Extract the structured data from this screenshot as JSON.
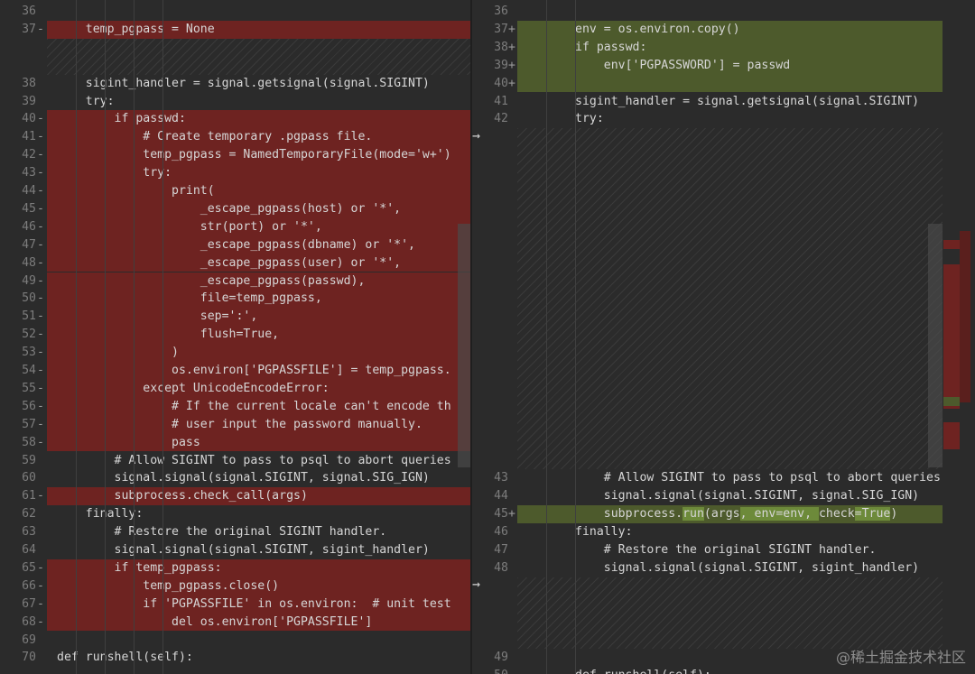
{
  "left_lines": [
    {
      "num": "36",
      "text": "",
      "type": "ctx"
    },
    {
      "num": "37",
      "marker": "-",
      "text": "    temp_pgpass = None",
      "type": "del"
    },
    {
      "num": "38",
      "text": "    sigint_handler = signal.getsignal(signal.SIGINT)",
      "type": "ctx"
    },
    {
      "num": "39",
      "text": "    try:",
      "type": "ctx"
    },
    {
      "num": "40",
      "marker": "-",
      "text": "        if passwd:",
      "type": "del"
    },
    {
      "num": "41",
      "marker": "-",
      "text": "            # Create temporary .pgpass file.",
      "type": "del"
    },
    {
      "num": "42",
      "marker": "-",
      "text": "            temp_pgpass = NamedTemporaryFile(mode='w+')",
      "type": "del"
    },
    {
      "num": "43",
      "marker": "-",
      "text": "            try:",
      "type": "del"
    },
    {
      "num": "44",
      "marker": "-",
      "text": "                print(",
      "type": "del"
    },
    {
      "num": "45",
      "marker": "-",
      "text": "                    _escape_pgpass(host) or '*',",
      "type": "del"
    },
    {
      "num": "46",
      "marker": "-",
      "text": "                    str(port) or '*',",
      "type": "del"
    },
    {
      "num": "47",
      "marker": "-",
      "text": "                    _escape_pgpass(dbname) or '*',",
      "type": "del"
    },
    {
      "num": "48",
      "marker": "-",
      "text": "                    _escape_pgpass(user) or '*',",
      "type": "del"
    },
    {
      "num": "49",
      "marker": "-",
      "text": "                    _escape_pgpass(passwd),",
      "type": "del"
    },
    {
      "num": "50",
      "marker": "-",
      "text": "                    file=temp_pgpass,",
      "type": "del"
    },
    {
      "num": "51",
      "marker": "-",
      "text": "                    sep=':',",
      "type": "del"
    },
    {
      "num": "52",
      "marker": "-",
      "text": "                    flush=True,",
      "type": "del"
    },
    {
      "num": "53",
      "marker": "-",
      "text": "                )",
      "type": "del"
    },
    {
      "num": "54",
      "marker": "-",
      "text": "                os.environ['PGPASSFILE'] = temp_pgpass.",
      "type": "del"
    },
    {
      "num": "55",
      "marker": "-",
      "text": "            except UnicodeEncodeError:",
      "type": "del"
    },
    {
      "num": "56",
      "marker": "-",
      "text": "                # If the current locale can't encode th",
      "type": "del"
    },
    {
      "num": "57",
      "marker": "-",
      "text": "                # user input the password manually.",
      "type": "del"
    },
    {
      "num": "58",
      "marker": "-",
      "text": "                pass",
      "type": "del"
    },
    {
      "num": "59",
      "text": "        # Allow SIGINT to pass to psql to abort queries",
      "type": "ctx"
    },
    {
      "num": "60",
      "text": "        signal.signal(signal.SIGINT, signal.SIG_IGN)",
      "type": "ctx"
    },
    {
      "num": "61",
      "marker": "-",
      "text": "        subprocess.check_call(args)",
      "type": "del"
    },
    {
      "num": "62",
      "text": "    finally:",
      "type": "ctx"
    },
    {
      "num": "63",
      "text": "        # Restore the original SIGINT handler.",
      "type": "ctx"
    },
    {
      "num": "64",
      "text": "        signal.signal(signal.SIGINT, sigint_handler)",
      "type": "ctx"
    },
    {
      "num": "65",
      "marker": "-",
      "text": "        if temp_pgpass:",
      "type": "del"
    },
    {
      "num": "66",
      "marker": "-",
      "text": "            temp_pgpass.close()",
      "type": "del"
    },
    {
      "num": "67",
      "marker": "-",
      "text": "            if 'PGPASSFILE' in os.environ:  # unit test",
      "type": "del"
    },
    {
      "num": "68",
      "marker": "-",
      "text": "                del os.environ['PGPASSFILE']",
      "type": "del"
    },
    {
      "num": "69",
      "text": "",
      "type": "ctx"
    },
    {
      "num": "70",
      "text": "def runshell(self):",
      "type": "ctx"
    }
  ],
  "right_lines": [
    {
      "num": "36",
      "text": "",
      "type": "ctx"
    },
    {
      "num": "37",
      "marker": "+",
      "text": "env = os.environ.copy()",
      "type": "add"
    },
    {
      "num": "38",
      "marker": "+",
      "text": "if passwd:",
      "type": "add"
    },
    {
      "num": "39",
      "marker": "+",
      "text": "    env['PGPASSWORD'] = passwd",
      "type": "add"
    },
    {
      "num": "40",
      "marker": "+",
      "text": "",
      "type": "add"
    },
    {
      "num": "41",
      "text": "sigint_handler = signal.getsignal(signal.SIGINT)",
      "type": "ctx"
    },
    {
      "num": "42",
      "text": "try:",
      "type": "ctx"
    },
    {
      "num": "43",
      "text": "    # Allow SIGINT to pass to psql to abort queries",
      "type": "ctx"
    },
    {
      "num": "44",
      "text": "    signal.signal(signal.SIGINT, signal.SIG_IGN)",
      "type": "ctx"
    },
    {
      "num": "45",
      "marker": "+",
      "text_parts": [
        "    subprocess.",
        "run",
        "(args",
        ", env=env, ",
        "check",
        "=True",
        ")"
      ],
      "type": "add"
    },
    {
      "num": "46",
      "text": "finally:",
      "type": "ctx"
    },
    {
      "num": "47",
      "text": "    # Restore the original SIGINT handler.",
      "type": "ctx"
    },
    {
      "num": "48",
      "text": "    signal.signal(signal.SIGINT, sigint_handler)",
      "type": "ctx"
    },
    {
      "num": "49",
      "text": "",
      "type": "ctx"
    },
    {
      "num": "50",
      "text": "def runshell(self):",
      "type": "ctx"
    }
  ],
  "arrows": [
    "→",
    "→"
  ],
  "watermark": "@稀土掘金技术社区",
  "colors": {
    "deleted": "#6e2321",
    "added": "#4d5a2c",
    "background": "#2b2b2b"
  }
}
